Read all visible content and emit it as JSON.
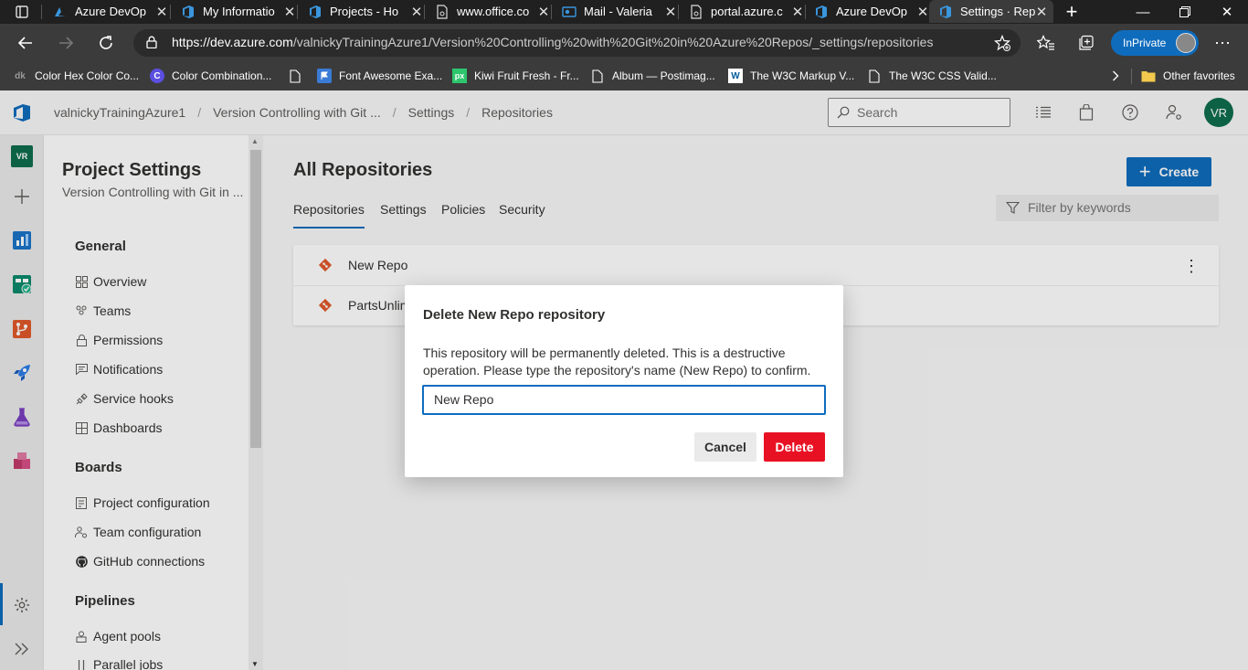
{
  "browser": {
    "tabs": [
      {
        "title": "Azure DevOp",
        "favicon": "azure-devops-icon",
        "active": false
      },
      {
        "title": "My Informatio",
        "favicon": "devops-icon",
        "active": false
      },
      {
        "title": "Projects - Ho",
        "favicon": "devops-icon",
        "active": false
      },
      {
        "title": "www.office.co",
        "favicon": "page-icon",
        "active": false
      },
      {
        "title": "Mail - Valeria",
        "favicon": "outlook-icon",
        "active": false
      },
      {
        "title": "portal.azure.c",
        "favicon": "page-icon",
        "active": false
      },
      {
        "title": "Azure DevOp",
        "favicon": "devops-icon",
        "active": false
      },
      {
        "title": "Settings · Rep",
        "favicon": "devops-icon",
        "active": true
      }
    ],
    "url_host": "https://dev.azure.com",
    "url_path": "/valnickyTrainingAzure1/Version%20Controlling%20with%20Git%20in%20Azure%20Repos/_settings/repositories",
    "inprivate_label": "InPrivate",
    "favorites": [
      {
        "label": "Color Hex Color Co...",
        "icon": "colorhex-icon"
      },
      {
        "label": "Color Combination...",
        "icon": "color-combination-icon"
      },
      {
        "label": "Font Awesome Exa...",
        "icon": "font-awesome-flag-icon"
      },
      {
        "label": "Kiwi Fruit Fresh - Fr...",
        "icon": "pixabay-icon"
      },
      {
        "label": "Album — Postimag...",
        "icon": "page-icon"
      },
      {
        "label": "The W3C Markup V...",
        "icon": "w3c-icon"
      },
      {
        "label": "The W3C CSS Valid...",
        "icon": "page-icon"
      }
    ],
    "other_favorites": "Other favorites"
  },
  "header": {
    "breadcrumbs": [
      "valnickyTrainingAzure1",
      "Version Controlling with Git ...",
      "Settings",
      "Repositories"
    ],
    "search_placeholder": "Search",
    "avatar_initials": "VR"
  },
  "rail": {
    "project_initials": "VR"
  },
  "sidebar": {
    "title": "Project Settings",
    "subtitle": "Version Controlling with Git in ...",
    "groups": [
      {
        "title": "General",
        "items": [
          "Overview",
          "Teams",
          "Permissions",
          "Notifications",
          "Service hooks",
          "Dashboards"
        ]
      },
      {
        "title": "Boards",
        "items": [
          "Project configuration",
          "Team configuration",
          "GitHub connections"
        ]
      },
      {
        "title": "Pipelines",
        "items": [
          "Agent pools",
          "Parallel jobs"
        ]
      }
    ]
  },
  "main": {
    "title": "All Repositories",
    "create_label": "Create",
    "tabs": [
      "Repositories",
      "Settings",
      "Policies",
      "Security"
    ],
    "selected_tab": "Repositories",
    "filter_placeholder": "Filter by keywords",
    "repos": [
      "New Repo",
      "PartsUnlim"
    ]
  },
  "dialog": {
    "title": "Delete New Repo repository",
    "message": "This repository will be permanently deleted. This is a destructive operation. Please type the repository's name (New Repo) to confirm.",
    "input_value": "New Repo",
    "cancel_label": "Cancel",
    "delete_label": "Delete"
  },
  "colors": {
    "accent": "#0f6cbd",
    "delete": "#e81123",
    "git_icon": "#e05a2b",
    "avatar": "#0f6e4f"
  }
}
